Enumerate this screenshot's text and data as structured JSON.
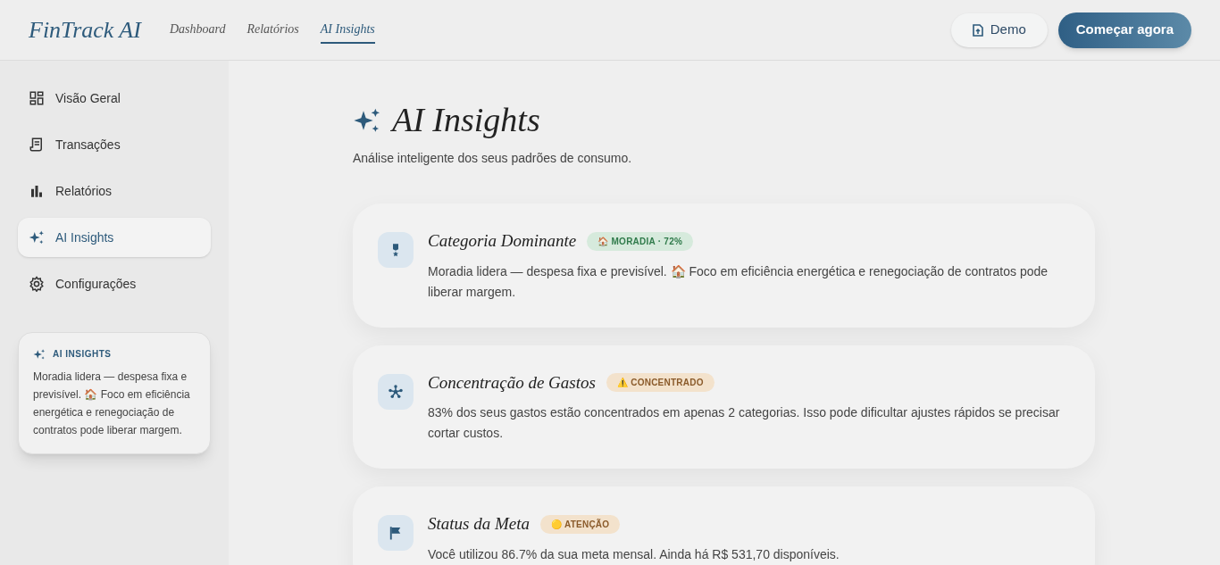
{
  "header": {
    "logo": "FinTrack AI",
    "nav": [
      {
        "label": "Dashboard",
        "selected": false
      },
      {
        "label": "Relatórios",
        "selected": false
      },
      {
        "label": "AI Insights",
        "selected": true
      }
    ],
    "demo_button": "Demo",
    "cta_button": "Começar agora"
  },
  "sidebar": {
    "items": [
      {
        "label": "Visão Geral",
        "selected": false
      },
      {
        "label": "Transações",
        "selected": false
      },
      {
        "label": "Relatórios",
        "selected": false
      },
      {
        "label": "AI Insights",
        "selected": true
      },
      {
        "label": "Configurações",
        "selected": false
      }
    ],
    "insight_card": {
      "title": "AI INSIGHTS",
      "text": "Moradia lidera — despesa fixa e previsível. 🏠 Foco em eficiência energética e renegociação de contratos pode liberar margem."
    }
  },
  "page": {
    "title": "AI Insights",
    "subtitle": "Análise inteligente dos seus padrões de consumo."
  },
  "cards": [
    {
      "title": "Categoria Dominante",
      "badge": "🏠 MORADIA · 72%",
      "kind": "success",
      "text": "Moradia lidera — despesa fixa e previsível. 🏠 Foco em eficiência energética e renegociação de contratos pode liberar margem."
    },
    {
      "title": "Concentração de Gastos",
      "badge": "⚠️ CONCENTRADO",
      "kind": "warning",
      "text": "83% dos seus gastos estão concentrados em apenas 2 categorias. Isso pode dificultar ajustes rápidos se precisar cortar custos."
    },
    {
      "title": "Status da Meta",
      "badge": "🟡 ATENÇÃO",
      "kind": "warning",
      "text": "Você utilizou 86.7% da sua meta mensal. Ainda há R$ 531,70 disponíveis."
    }
  ]
}
